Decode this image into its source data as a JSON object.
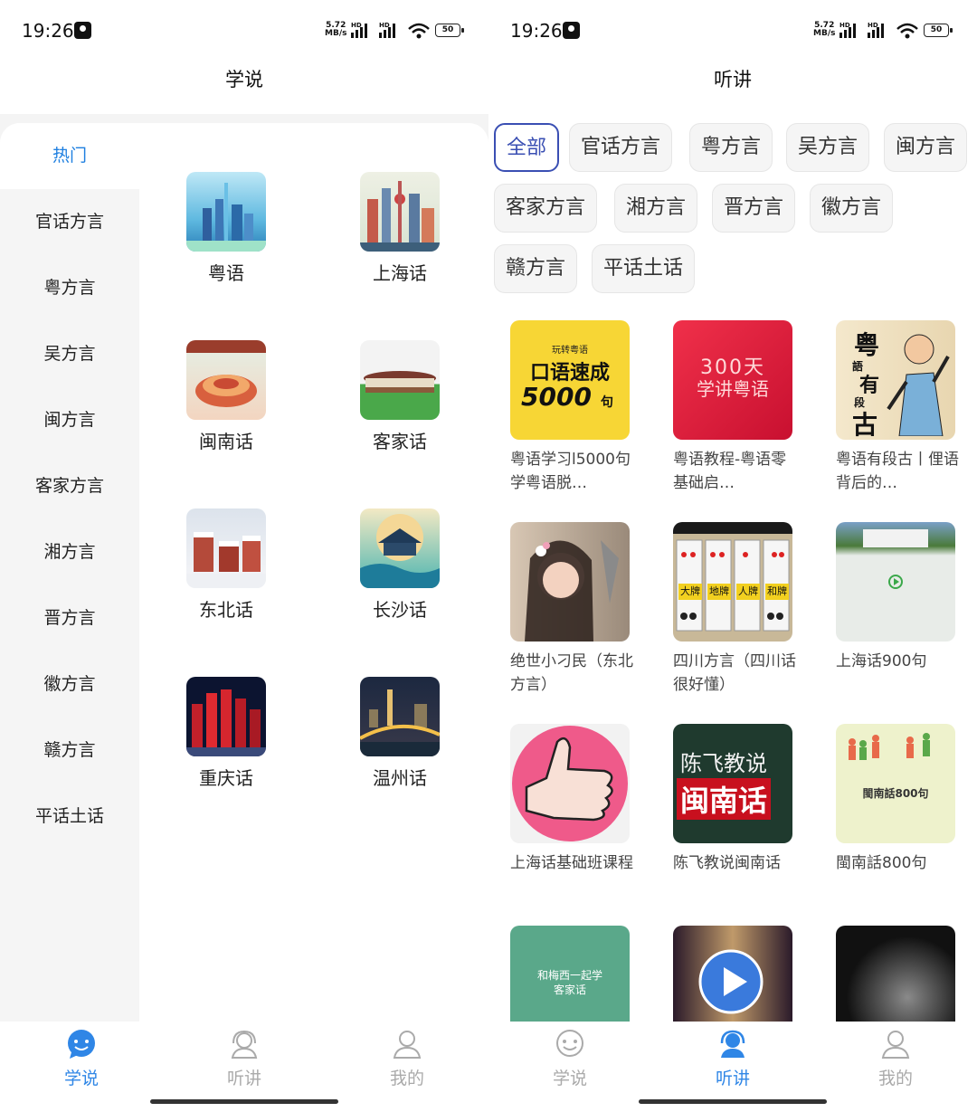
{
  "status": {
    "time": "19:26",
    "speed_value": "5.72",
    "speed_unit": "MB/s",
    "battery": "50",
    "hd": "HD"
  },
  "left": {
    "title": "学说",
    "sidebar": [
      "热门",
      "官话方言",
      "粤方言",
      "吴方言",
      "闽方言",
      "客家方言",
      "湘方言",
      "晋方言",
      "徽方言",
      "赣方言",
      "平话土话"
    ],
    "grid": [
      "粤语",
      "上海话",
      "闽南话",
      "客家话",
      "东北话",
      "长沙话",
      "重庆话",
      "温州话"
    ]
  },
  "right": {
    "title": "听讲",
    "chips": [
      "全部",
      "官话方言",
      "粤方言",
      "吴方言",
      "闽方言",
      "客家方言",
      "湘方言",
      "晋方言",
      "徽方言",
      "赣方言",
      "平话土话"
    ],
    "cards": [
      {
        "title": "粤语学习l5000句学粤语脱…",
        "cover": [
          "玩转粤语",
          "口语速成",
          "5000",
          "句"
        ]
      },
      {
        "title": "粤语教程-粤语零基础启…",
        "cover": [
          "300天",
          "学讲粤语"
        ]
      },
      {
        "title": "粤语有段古丨俚语背后的…",
        "cover": [
          "粤",
          "語",
          "有",
          "段",
          "古"
        ]
      },
      {
        "title": "绝世小刁民（东北方言）",
        "cover": []
      },
      {
        "title": "四川方言（四川话很好懂）",
        "cover": [
          "大牌",
          "地牌",
          "人牌",
          "和牌"
        ]
      },
      {
        "title": "上海话900句",
        "cover": []
      },
      {
        "title": "上海话基础班课程",
        "cover": []
      },
      {
        "title": "陈飞教说闽南话",
        "cover": [
          "陈飞教说",
          "闽南话"
        ]
      },
      {
        "title": "閩南話800句",
        "cover": [
          "閩南話800句"
        ]
      },
      {
        "title": "",
        "cover": [
          "和梅西一起学",
          "客家话"
        ]
      },
      {
        "title": "",
        "cover": []
      },
      {
        "title": "",
        "cover": []
      }
    ]
  },
  "tabs": [
    "学说",
    "听讲",
    "我的"
  ],
  "colors": {
    "accent": "#2f86e6",
    "chip_selected": "#3a4fb3",
    "inactive": "#aaaaaa"
  }
}
